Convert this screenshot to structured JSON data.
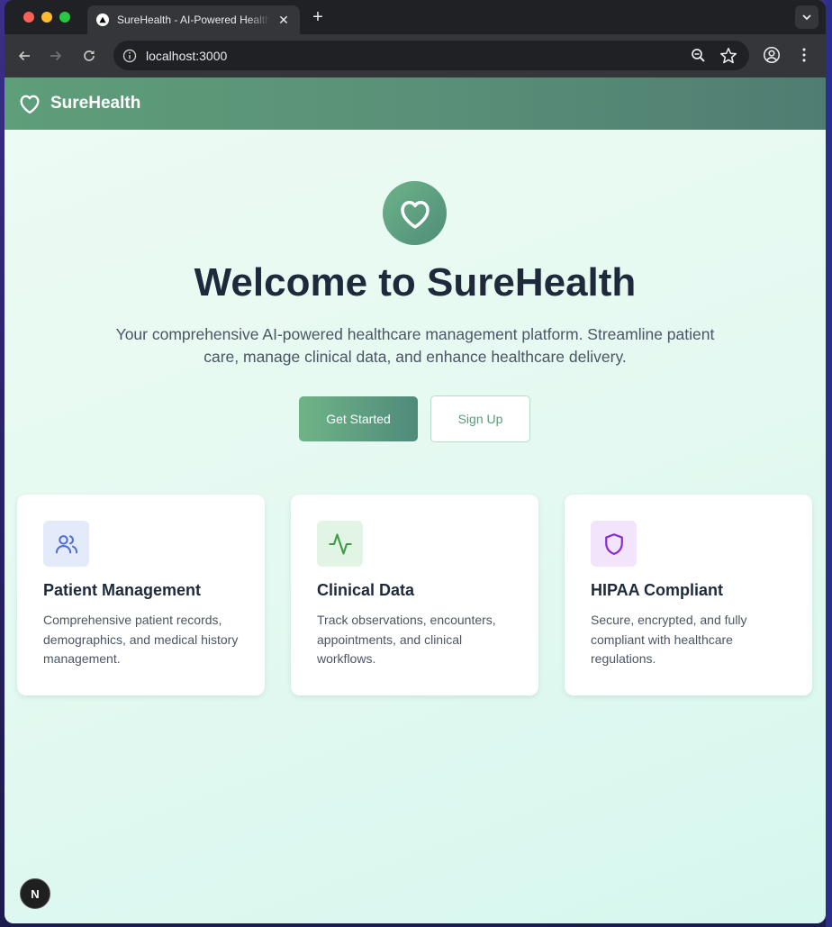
{
  "browser": {
    "tab_title": "SureHealth - AI-Powered Healthcare Management",
    "tab_close": "✕",
    "new_tab": "+",
    "url": "localhost:3000"
  },
  "header": {
    "brand": "SureHealth",
    "color": "#5e9e79"
  },
  "hero": {
    "title": "Welcome to SureHealth",
    "subtitle": "Your comprehensive AI-powered healthcare management platform. Streamline patient care, manage clinical data, and enhance healthcare delivery.",
    "primary_button": "Get Started",
    "secondary_button": "Sign Up"
  },
  "features": [
    {
      "icon": "users-icon",
      "icon_color": "#4f6fd8",
      "icon_bg": "#e3ebfb",
      "title": "Patient Management",
      "description": "Comprehensive patient records, demographics, and medical history management."
    },
    {
      "icon": "activity-icon",
      "icon_color": "#3f9a49",
      "icon_bg": "#e2f5e4",
      "title": "Clinical Data",
      "description": "Track observations, encounters, appointments, and clinical workflows."
    },
    {
      "icon": "shield-icon",
      "icon_color": "#8a2bd6",
      "icon_bg": "#f1e4fb",
      "title": "HIPAA Compliant",
      "description": "Secure, encrypted, and fully compliant with healthcare regulations."
    }
  ],
  "dev_badge": "N"
}
